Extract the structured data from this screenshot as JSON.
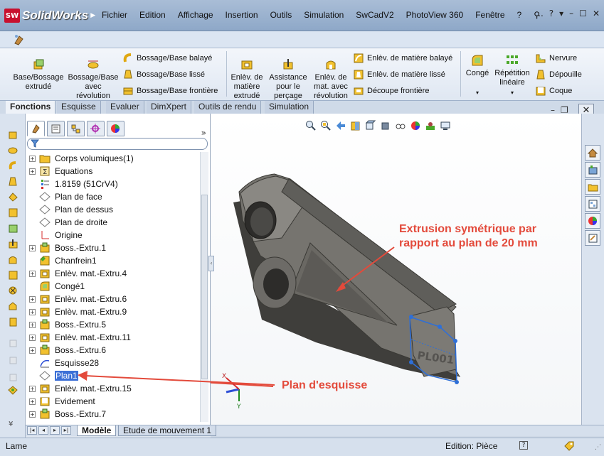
{
  "app": {
    "logo_badge": "SW",
    "logo_text": "SolidWorks",
    "menu": [
      "Fichier",
      "Edition",
      "Affichage",
      "Insertion",
      "Outils",
      "Simulation",
      "SwCadV2",
      "PhotoView 360",
      "Fenêtre",
      "?"
    ],
    "window_controls": [
      "..",
      "?",
      "▾",
      "–",
      "☐",
      "✕"
    ]
  },
  "ribbon": {
    "base_bossage": "Base/Bossage extrudé",
    "bossage_revolution": "Bossage/Base avec révolution",
    "bossage_balaye": "Bossage/Base balayé",
    "bossage_lisse": "Bossage/Base lissé",
    "bossage_frontiere": "Bossage/Base frontière",
    "enlev_extrude": "Enlèv. de matière extrudé",
    "assistance_percage": "Assistance pour le perçage",
    "enlev_revolution": "Enlèv. de mat. avec révolution",
    "enlev_balaye": "Enlèv. de matière balayé",
    "enlev_lisse": "Enlèv. de matière lissé",
    "decoupe_frontiere": "Découpe frontière",
    "conge": "Congé",
    "repetition_lineaire": "Répétition linéaire",
    "nervure": "Nervure",
    "depouille": "Dépouille",
    "coque": "Coque"
  },
  "command_tabs": [
    "Fonctions",
    "Esquisse",
    "Evaluer",
    "DimXpert",
    "Outils de rendu",
    "Simulation"
  ],
  "tree": {
    "items": [
      {
        "label": "Corps volumiques(1)",
        "expandable": true,
        "icon": "folder-icon"
      },
      {
        "label": "Equations",
        "expandable": true,
        "icon": "equations-icon"
      },
      {
        "label": "1.8159 (51CrV4)",
        "expandable": false,
        "icon": "material-icon"
      },
      {
        "label": "Plan de face",
        "expandable": false,
        "icon": "plane-icon"
      },
      {
        "label": "Plan de dessus",
        "expandable": false,
        "icon": "plane-icon"
      },
      {
        "label": "Plan de droite",
        "expandable": false,
        "icon": "plane-icon"
      },
      {
        "label": "Origine",
        "expandable": false,
        "icon": "origin-icon"
      },
      {
        "label": "Boss.-Extru.1",
        "expandable": true,
        "icon": "extrude-icon"
      },
      {
        "label": "Chanfrein1",
        "expandable": false,
        "icon": "chamfer-icon"
      },
      {
        "label": "Enlèv. mat.-Extru.4",
        "expandable": true,
        "icon": "cut-icon"
      },
      {
        "label": "Congé1",
        "expandable": false,
        "icon": "fillet-icon"
      },
      {
        "label": "Enlèv. mat.-Extru.6",
        "expandable": true,
        "icon": "cut-icon"
      },
      {
        "label": "Enlèv. mat.-Extru.9",
        "expandable": true,
        "icon": "cut-icon"
      },
      {
        "label": "Boss.-Extru.5",
        "expandable": true,
        "icon": "extrude-icon"
      },
      {
        "label": "Enlèv. mat.-Extru.11",
        "expandable": true,
        "icon": "cut-icon"
      },
      {
        "label": "Boss.-Extru.6",
        "expandable": true,
        "icon": "extrude-icon"
      },
      {
        "label": "Esquisse28",
        "expandable": false,
        "icon": "sketch-icon"
      },
      {
        "label": "Plan1",
        "expandable": false,
        "icon": "plane-icon",
        "selected": true
      },
      {
        "label": "Enlèv. mat.-Extru.15",
        "expandable": true,
        "icon": "cut-icon"
      },
      {
        "label": "Evidement",
        "expandable": true,
        "icon": "shell-icon"
      },
      {
        "label": "Boss.-Extru.7",
        "expandable": true,
        "icon": "extrude-icon"
      }
    ],
    "expand_glyph": "»"
  },
  "bottom_tabs": [
    "Modèle",
    "Etude de mouvement 1"
  ],
  "status": {
    "left": "Lame",
    "edition": "Edition: Pièce",
    "help": "?"
  },
  "annotations": {
    "extrusion_line1": "Extrusion symétrique par",
    "extrusion_line2": "rapport au plan de 20 mm",
    "plan_esquisse": "Plan d'esquisse"
  },
  "part": {
    "engraving": "PL001",
    "triad_x": "X",
    "triad_y": "Y"
  },
  "colors": {
    "annotation": "#e34a3b",
    "selection": "#3b6fd6",
    "part_body": "#6b6a66",
    "sketch": "#2e6fd8"
  }
}
